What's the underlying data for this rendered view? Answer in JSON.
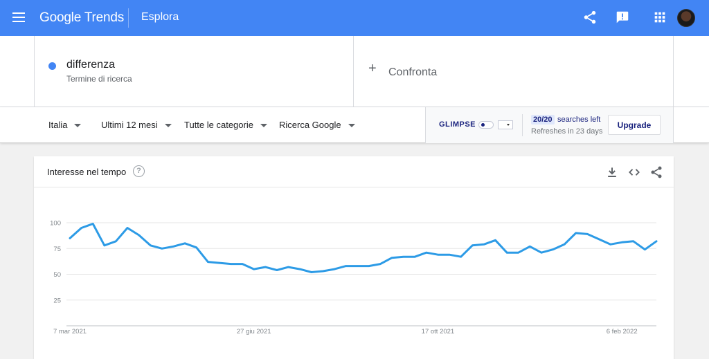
{
  "header": {
    "logo_google": "Google",
    "logo_trends": "Trends",
    "page": "Esplora"
  },
  "search": {
    "term": "differenza",
    "term_type": "Termine di ricerca",
    "term_color": "#4285f4",
    "compare_label": "Confronta"
  },
  "filters": {
    "region": "Italia",
    "period": "Ultimi 12 mesi",
    "category": "Tutte le categorie",
    "property": "Ricerca Google"
  },
  "glimpse": {
    "logo": "GLIMPSE",
    "quota": "20/20",
    "quota_label": "searches left",
    "refresh": "Refreshes in 23 days",
    "upgrade": "Upgrade"
  },
  "card": {
    "title": "Interesse nel tempo",
    "help": "?"
  },
  "icons": {
    "menu": "menu-icon",
    "share": "share-icon",
    "feedback": "feedback-icon",
    "apps": "apps-grid-icon",
    "download": "download-icon",
    "embed": "embed-code-icon",
    "card_share": "share-icon"
  },
  "colors": {
    "brand": "#4285f4",
    "series": "#2d9be6",
    "glimpse": "#1a237e"
  },
  "chart_data": {
    "type": "line",
    "title": "Interesse nel tempo",
    "ylim": [
      0,
      100
    ],
    "yticks": [
      25,
      50,
      75,
      100
    ],
    "ytick_labels": [
      "25",
      "50",
      "75",
      "100"
    ],
    "x_labels": [
      "7 mar 2021",
      "27 giu 2021",
      "17 ott 2021",
      "6 feb 2022"
    ],
    "x_label_indices": [
      0,
      16,
      32,
      48
    ],
    "grid": true,
    "series": [
      {
        "values": [
          85,
          95,
          99,
          78,
          82,
          95,
          88,
          78,
          75,
          77,
          80,
          76,
          62,
          61,
          60,
          60,
          55,
          57,
          54,
          57,
          55,
          52,
          53,
          55,
          58,
          58,
          58,
          60,
          66,
          67,
          67,
          71,
          69,
          69,
          67,
          78,
          79,
          83,
          71,
          71,
          77,
          71,
          74,
          79,
          90,
          89,
          84,
          79,
          81,
          82,
          74,
          82
        ]
      }
    ]
  }
}
